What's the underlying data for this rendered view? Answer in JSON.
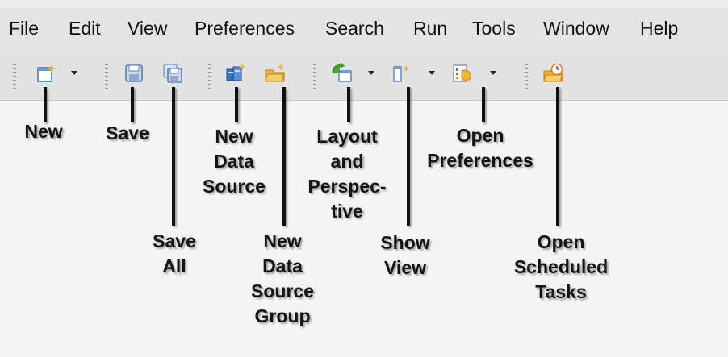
{
  "menu": {
    "items": [
      "File",
      "Edit",
      "View",
      "Preferences",
      "Search",
      "Run",
      "Tools",
      "Window",
      "Help"
    ]
  },
  "toolbar": {
    "buttons": [
      {
        "icon": "new-icon",
        "has_dropdown": true
      },
      {
        "icon": "save-icon",
        "has_dropdown": false
      },
      {
        "icon": "save-all-icon",
        "has_dropdown": false
      },
      {
        "icon": "new-data-source-icon",
        "has_dropdown": false
      },
      {
        "icon": "new-data-source-group-icon",
        "has_dropdown": false
      },
      {
        "icon": "layout-perspective-icon",
        "has_dropdown": true
      },
      {
        "icon": "show-view-icon",
        "has_dropdown": true
      },
      {
        "icon": "open-preferences-icon",
        "has_dropdown": true
      },
      {
        "icon": "open-scheduled-tasks-icon",
        "has_dropdown": false
      }
    ]
  },
  "callouts": {
    "new": "New",
    "save": "Save",
    "save_all": "Save\nAll",
    "new_data_source": "New\nData\nSource",
    "new_data_source_group": "New\nData\nSource\nGroup",
    "layout_and_perspective": "Layout\nand\nPerspec-\ntive",
    "show_view": "Show\nView",
    "open_preferences": "Open\nPreferences",
    "open_scheduled_tasks": "Open\nScheduled\nTasks"
  },
  "colors": {
    "menubar_bg": "#e4e4e4",
    "toolbar_bg": "#e2e2e2",
    "page_bg": "#f4f4f4",
    "icon_blue": "#3a74c4",
    "icon_yellow": "#f2b632",
    "icon_green": "#3a9a2c",
    "icon_orange": "#e47a1e"
  }
}
